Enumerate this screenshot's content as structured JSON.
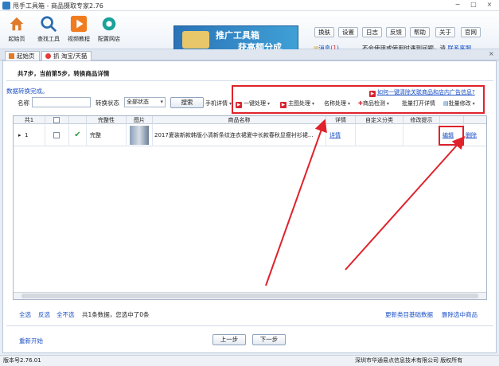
{
  "window": {
    "title": "甩手工具箱 - 商品摄取专家2.76",
    "controls": [
      "−",
      "□",
      "×"
    ]
  },
  "toolbar": {
    "items": [
      {
        "label": "起始页",
        "icon": "home-icon"
      },
      {
        "label": "查找工具",
        "icon": "search-icon"
      },
      {
        "label": "视频教程",
        "icon": "play-icon"
      },
      {
        "label": "配置网店",
        "icon": "gear-icon"
      }
    ],
    "banner": {
      "line1": "推广工具箱",
      "line2": "获高额分成"
    },
    "buttons": [
      "换肤",
      "设置",
      "日志",
      "反馈",
      "帮助",
      "关于",
      "官网"
    ],
    "message_label": "消息(",
    "message_count": "1",
    "message_close": ")",
    "notice_text": "不会使用或使用时遇到问题，请",
    "notice_link": "联系客服"
  },
  "tabs": [
    {
      "label": "起始页",
      "icon": "home-icon",
      "active": false
    },
    {
      "label": "抓 淘宝/天猫",
      "icon": "taobao-icon",
      "active": true
    }
  ],
  "panel": {
    "step_text": "共7步，当前第5步，转换商品详情",
    "subtitle": "数据转换完成。",
    "filter": {
      "name_label": "名称",
      "name_value": "",
      "status_label": "转换状态",
      "status_value": "全部状态",
      "search_button": "搜索"
    },
    "help_link": "如何一键清除关联商品和店内广告信息?",
    "ops": [
      {
        "label": "手机详情",
        "badge": false
      },
      {
        "label": "一键处理",
        "badge": true
      },
      {
        "label": "主图处理",
        "badge": true
      },
      {
        "label": "名称处理",
        "badge": false
      },
      {
        "label": "商品检测",
        "badge": false
      },
      {
        "label": "批量打开详情",
        "badge": false
      },
      {
        "label": "批量修改",
        "badge": false
      }
    ]
  },
  "grid": {
    "columns": [
      "共1",
      "",
      "",
      "完整性",
      "图片",
      "商品名称",
      "详情",
      "自定义分类",
      "修改提示",
      "",
      ""
    ],
    "rows": [
      {
        "index": "1",
        "status_icon": "check-icon",
        "integrity": "完整",
        "name": "2017夏装新款韩版小清新条纹连衣裙夏中长款春秋显瘦衬衫裙...",
        "detail_link": "详情",
        "custom_category": "",
        "edit_hint": "",
        "edit_link": "编辑",
        "delete_link": "删除"
      }
    ]
  },
  "footer": {
    "select_all": "全选",
    "invert": "反选",
    "select_none": "全不选",
    "summary": "共1条数据，您选中了0条",
    "update_category": "更新类目基础数据",
    "delete_selected": "删除选中商品",
    "restart": "重新开始",
    "prev": "上一步",
    "next": "下一步"
  },
  "status": {
    "version": "版本号2.76.01",
    "company": "深圳市华通易点信息技术有限公司 版权所有"
  }
}
